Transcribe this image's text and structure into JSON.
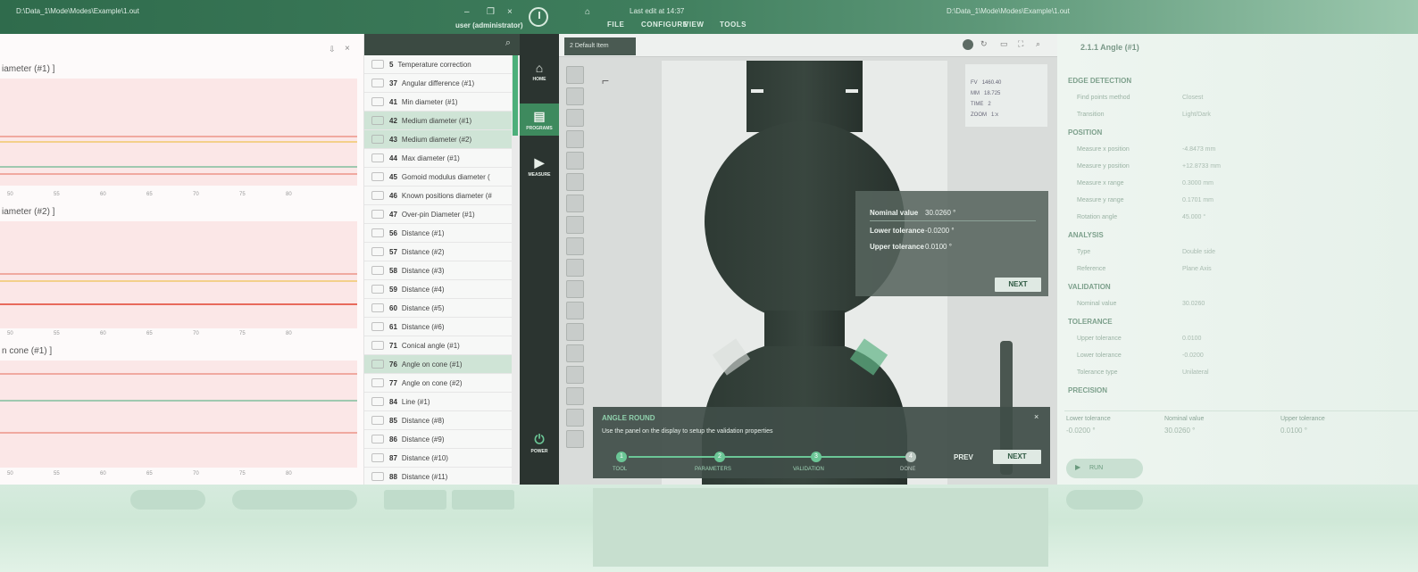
{
  "topbar": {
    "file_path_left": "D:\\Data_1\\Mode\\Modes\\Example\\1.out",
    "user_label": "user (administrator)",
    "center_status": "Last edit at 14:37",
    "file_path_right": "D:\\Data_1\\Mode\\Modes\\Example\\1.out",
    "menu": [
      "FILE",
      "CONFIGURE",
      "VIEW",
      "TOOLS"
    ]
  },
  "charts": [
    {
      "title": "iameter (#1) ]",
      "x_ticks": [
        "50",
        "55",
        "60",
        "65",
        "70",
        "75",
        "80"
      ]
    },
    {
      "title": "iameter (#2) ]",
      "x_ticks": [
        "50",
        "55",
        "60",
        "65",
        "70",
        "75",
        "80"
      ]
    },
    {
      "title": "n cone (#1) ]",
      "x_ticks": [
        "50",
        "55",
        "60",
        "65",
        "70",
        "75",
        "80"
      ]
    }
  ],
  "list": {
    "items": [
      {
        "num": "5",
        "label": "Temperature correction",
        "selected": false
      },
      {
        "num": "37",
        "label": "Angular difference (#1)",
        "selected": false
      },
      {
        "num": "41",
        "label": "Min diameter (#1)",
        "selected": false
      },
      {
        "num": "42",
        "label": "Medium diameter (#1)",
        "selected": true
      },
      {
        "num": "43",
        "label": "Medium diameter (#2)",
        "selected": true
      },
      {
        "num": "44",
        "label": "Max diameter (#1)",
        "selected": false
      },
      {
        "num": "45",
        "label": "Gomoid modulus diameter (",
        "selected": false
      },
      {
        "num": "46",
        "label": "Known positions diameter (#",
        "selected": false
      },
      {
        "num": "47",
        "label": "Over-pin Diameter (#1)",
        "selected": false
      },
      {
        "num": "56",
        "label": "Distance (#1)",
        "selected": false
      },
      {
        "num": "57",
        "label": "Distance (#2)",
        "selected": false
      },
      {
        "num": "58",
        "label": "Distance (#3)",
        "selected": false
      },
      {
        "num": "59",
        "label": "Distance (#4)",
        "selected": false
      },
      {
        "num": "60",
        "label": "Distance (#5)",
        "selected": false
      },
      {
        "num": "61",
        "label": "Distance (#6)",
        "selected": false
      },
      {
        "num": "71",
        "label": "Conical angle (#1)",
        "selected": false
      },
      {
        "num": "76",
        "label": "Angle on cone (#1)",
        "selected": true
      },
      {
        "num": "77",
        "label": "Angle on cone (#2)",
        "selected": false
      },
      {
        "num": "84",
        "label": "Line (#1)",
        "selected": false
      },
      {
        "num": "85",
        "label": "Distance (#8)",
        "selected": false
      },
      {
        "num": "86",
        "label": "Distance (#9)",
        "selected": false
      },
      {
        "num": "87",
        "label": "Distance (#10)",
        "selected": false
      },
      {
        "num": "88",
        "label": "Distance (#11)",
        "selected": false
      }
    ]
  },
  "nav": {
    "home": "HOME",
    "programs": "PROGRAMS",
    "measure": "MEASURE",
    "power": "POWER"
  },
  "viewer": {
    "tab_label": "2 Default Item",
    "info_rows": [
      [
        "FV",
        "1460.40"
      ],
      [
        "MM",
        "18.725"
      ],
      [
        "TIME",
        "2"
      ],
      [
        "ZOOM",
        "1:x"
      ]
    ],
    "popup": {
      "nominal_label": "Nominal value",
      "nominal_value": "30.0260 °",
      "lower_label": "Lower tolerance",
      "lower_value": "-0.0200 °",
      "upper_label": "Upper tolerance",
      "upper_value": "0.0100 °",
      "next": "NEXT"
    },
    "wizard": {
      "title": "ANGLE ROUND",
      "subtitle": "Use the panel on the display to setup the validation properties",
      "steps": [
        {
          "n": "1",
          "label": "TOOL"
        },
        {
          "n": "2",
          "label": "PARAMETERS"
        },
        {
          "n": "3",
          "label": "VALIDATION"
        },
        {
          "n": "4",
          "label": "DONE"
        }
      ],
      "prev": "PREV",
      "next": "NEXT"
    }
  },
  "props": {
    "title": "2.1.1 Angle (#1)",
    "rows": [
      {
        "kind": "sec",
        "text": "EDGE DETECTION"
      },
      {
        "kind": "kv",
        "k": "Find points method",
        "v": "Closest"
      },
      {
        "kind": "kv",
        "k": "Transition",
        "v": "Light/Dark"
      },
      {
        "kind": "sec",
        "text": "POSITION"
      },
      {
        "kind": "kv",
        "k": "Measure x position",
        "v": "-4.8473 mm"
      },
      {
        "kind": "kv",
        "k": "Measure y position",
        "v": "+12.8733 mm"
      },
      {
        "kind": "kv",
        "k": "Measure x range",
        "v": "0.3000 mm"
      },
      {
        "kind": "kv",
        "k": "Measure y range",
        "v": "0.1701 mm"
      },
      {
        "kind": "kv",
        "k": "Rotation angle",
        "v": "45.000 °"
      },
      {
        "kind": "sec",
        "text": "ANALYSIS"
      },
      {
        "kind": "kv",
        "k": "Type",
        "v": "Double side"
      },
      {
        "kind": "kv",
        "k": "Reference",
        "v": "Plane Axis"
      },
      {
        "kind": "sec",
        "text": "VALIDATION"
      },
      {
        "kind": "kv",
        "k": "Nominal value",
        "v": "30.0260"
      },
      {
        "kind": "sec",
        "text": "TOLERANCE"
      },
      {
        "kind": "kv",
        "k": "Upper tolerance",
        "v": "0.0100"
      },
      {
        "kind": "kv",
        "k": "Lower tolerance",
        "v": "-0.0200"
      },
      {
        "kind": "kv",
        "k": "Tolerance type",
        "v": "Unilateral"
      },
      {
        "kind": "sec",
        "text": "PRECISION"
      }
    ],
    "bottom_labels": [
      "Lower tolerance",
      "Nominal value",
      "Upper tolerance"
    ],
    "bottom_values": [
      "-0.0200 °",
      "30.0260 °",
      "0.0100 °"
    ],
    "run_label": "RUN"
  }
}
